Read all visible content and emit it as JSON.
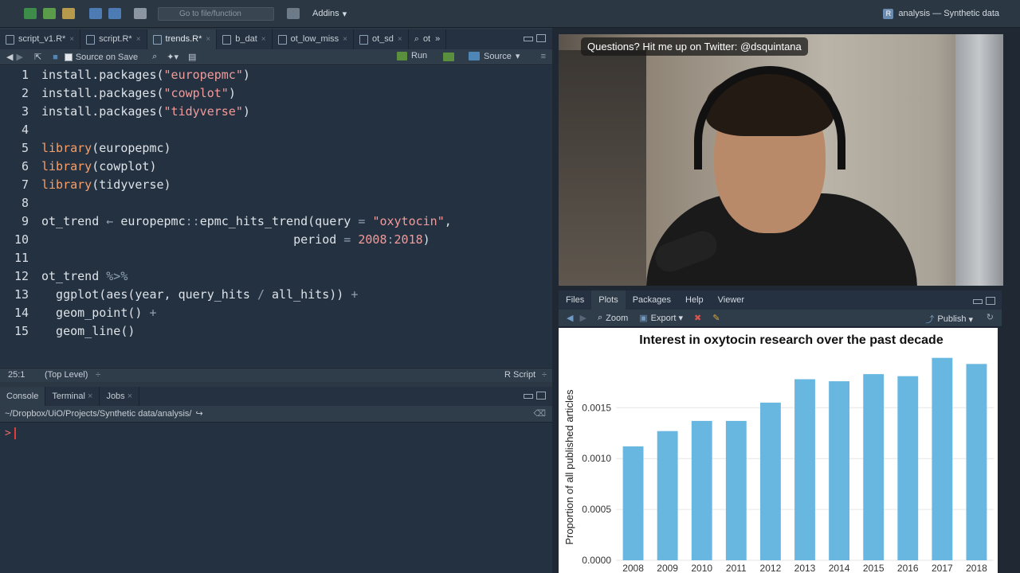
{
  "topbar": {
    "goto_placeholder": "Go to file/function",
    "addins_label": "Addins",
    "project_label": "analysis — Synthetic data"
  },
  "editor": {
    "tabs": [
      {
        "label": "script_v1.R*"
      },
      {
        "label": "script.R*"
      },
      {
        "label": "trends.R*"
      },
      {
        "label": "b_dat"
      },
      {
        "label": "ot_low_miss"
      },
      {
        "label": "ot_sd"
      },
      {
        "label": "ot"
      }
    ],
    "toolbar": {
      "source_on_save": "Source on Save",
      "run": "Run",
      "source": "Source"
    },
    "status": {
      "position": "25:1",
      "level": "(Top Level)",
      "language": "R Script"
    }
  },
  "console": {
    "tabs": [
      "Console",
      "Terminal",
      "Jobs"
    ],
    "path": "~/Dropbox/UiO/Projects/Synthetic data/analysis/",
    "prompt": ">"
  },
  "webcam": {
    "banner": "Questions? Hit me up on Twitter: @dsquintana"
  },
  "files_pane": {
    "tabs": [
      "Files",
      "Plots",
      "Packages",
      "Help",
      "Viewer"
    ],
    "toolbar": {
      "zoom": "Zoom",
      "export": "Export",
      "publish": "Publish"
    }
  },
  "chart_data": {
    "type": "bar",
    "title": "Interest in oxytocin research over the past decade",
    "xlabel": "",
    "ylabel": "Proportion of all published articles",
    "categories": [
      "2008",
      "2009",
      "2010",
      "2011",
      "2012",
      "2013",
      "2014",
      "2015",
      "2016",
      "2017",
      "2018"
    ],
    "values": [
      0.00112,
      0.00127,
      0.00137,
      0.00137,
      0.00155,
      0.00178,
      0.00176,
      0.00183,
      0.00181,
      0.00199,
      0.00193
    ],
    "yticks": [
      "0.0000",
      "0.0005",
      "0.0010",
      "0.0015"
    ],
    "ylim": [
      0,
      0.00205
    ],
    "bar_color": "#67b7e1"
  }
}
